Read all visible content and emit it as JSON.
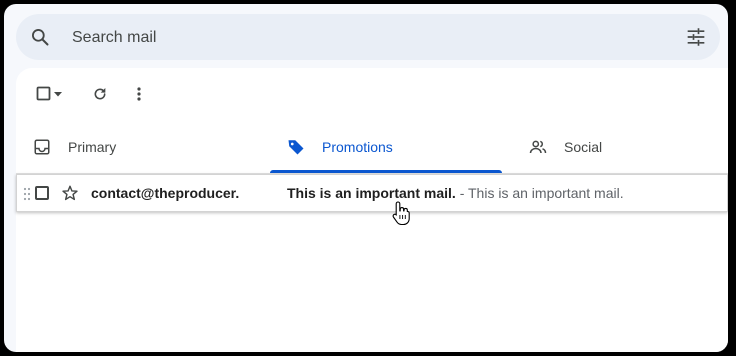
{
  "search": {
    "placeholder": "Search mail",
    "value": ""
  },
  "toolbar": {
    "select_icon": "checkbox-icon",
    "select_menu_icon": "caret-down-icon",
    "refresh_icon": "refresh-icon",
    "more_icon": "more-vert-icon"
  },
  "tabs": [
    {
      "label": "Primary",
      "icon": "inbox-icon",
      "active": false
    },
    {
      "label": "Promotions",
      "icon": "tag-icon",
      "active": true
    },
    {
      "label": "Social",
      "icon": "people-icon",
      "active": false
    }
  ],
  "mails": [
    {
      "sender": "contact@theproducer.",
      "subject": "This is an important mail.",
      "snippet": " - This is an important mail.",
      "starred": false,
      "selected": false
    }
  ],
  "colors": {
    "accent": "#0b57d0",
    "background": "#f6f8fc",
    "search_bg": "#e9eef6",
    "text": "#1f1f1f",
    "muted": "#444746"
  }
}
